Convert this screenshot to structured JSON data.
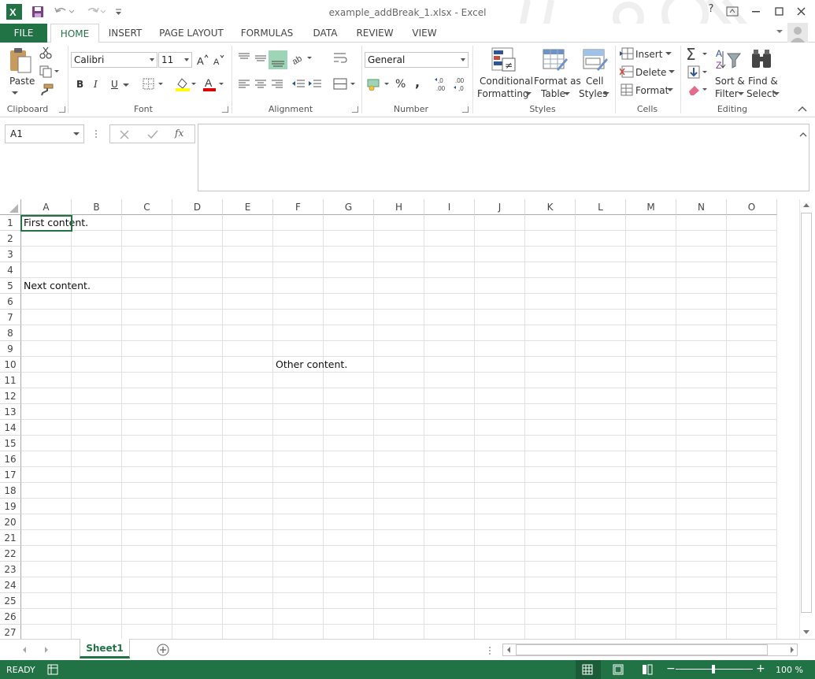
{
  "window": {
    "title": "example_addBreak_1.xlsx - Excel",
    "help": "?",
    "colors": {
      "accent": "#217346"
    }
  },
  "tabs": [
    {
      "label": "FILE"
    },
    {
      "label": "HOME"
    },
    {
      "label": "INSERT"
    },
    {
      "label": "PAGE LAYOUT"
    },
    {
      "label": "FORMULAS"
    },
    {
      "label": "DATA"
    },
    {
      "label": "REVIEW"
    },
    {
      "label": "VIEW"
    }
  ],
  "ribbon": {
    "clipboard": {
      "paste": "Paste",
      "label": "Clipboard"
    },
    "font": {
      "family": "Calibri",
      "size": "11",
      "label": "Font",
      "bold": "B",
      "italic": "I",
      "underline": "U"
    },
    "alignment": {
      "label": "Alignment"
    },
    "number": {
      "format": "General",
      "label": "Number",
      "percent": "%",
      "comma": ","
    },
    "styles": {
      "conditional_1": "Conditional",
      "conditional_2": "Formatting",
      "format_table_1": "Format as",
      "format_table_2": "Table",
      "cell_styles_1": "Cell",
      "cell_styles_2": "Styles",
      "label": "Styles"
    },
    "cells": {
      "insert": "Insert",
      "delete": "Delete",
      "format": "Format",
      "label": "Cells"
    },
    "editing": {
      "sort_1": "Sort &",
      "sort_2": "Filter",
      "find_1": "Find &",
      "find_2": "Select",
      "label": "Editing"
    }
  },
  "formula_bar": {
    "name_box": "A1",
    "fx": "fx",
    "value": ""
  },
  "grid": {
    "columns": [
      "A",
      "B",
      "C",
      "D",
      "E",
      "F",
      "G",
      "H",
      "I",
      "J",
      "K",
      "L",
      "M",
      "N",
      "O"
    ],
    "rows": [
      "1",
      "2",
      "3",
      "4",
      "5",
      "6",
      "7",
      "8",
      "9",
      "10",
      "11",
      "12",
      "13",
      "14",
      "15",
      "16",
      "17",
      "18",
      "19",
      "20",
      "21",
      "22",
      "23",
      "24",
      "25",
      "26",
      "27"
    ],
    "cells": [
      {
        "ref": "A1",
        "value": "First content."
      },
      {
        "ref": "A5",
        "value": "Next content."
      },
      {
        "ref": "F10",
        "value": "Other content."
      }
    ]
  },
  "sheets": [
    {
      "name": "Sheet1",
      "active": true
    }
  ],
  "status": {
    "mode": "READY",
    "zoom": "100 %"
  }
}
